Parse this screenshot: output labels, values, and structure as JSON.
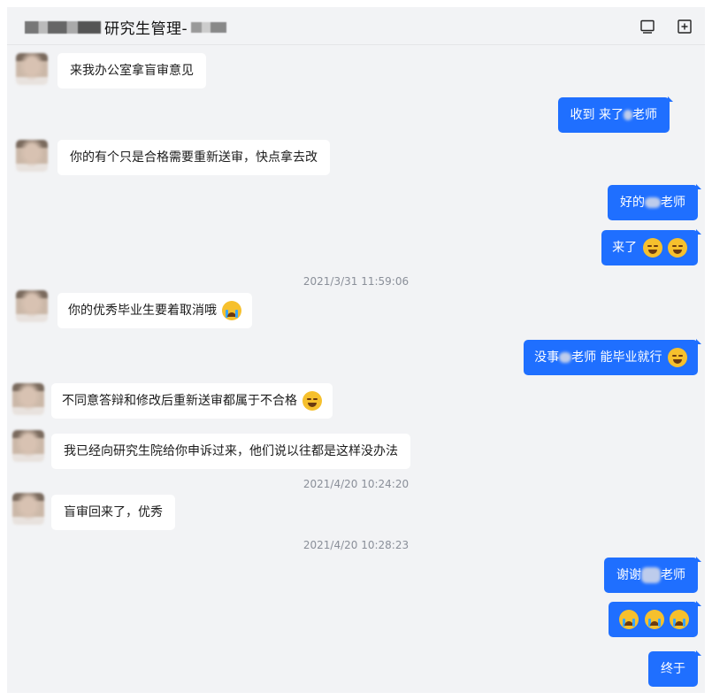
{
  "header": {
    "title": "研究生管理-",
    "icons": [
      "screen-icon",
      "add-box-icon"
    ]
  },
  "messages": [
    {
      "side": "left",
      "text": "来我办公室拿盲审意见"
    },
    {
      "side": "right",
      "pre": "收到 来了",
      "post": "老师"
    },
    {
      "side": "left",
      "text": "你的有个只是合格需要重新送审，快点拿去改"
    },
    {
      "side": "right",
      "pre": "好的",
      "post": "老师"
    },
    {
      "side": "right",
      "pre": "来了",
      "emoji": [
        "laugh-cry-emoji",
        "laugh-cry-emoji"
      ]
    },
    {
      "timestamp": "2021/3/31 11:59:06"
    },
    {
      "side": "left",
      "text": "你的优秀毕业生要着取消哦",
      "emoji": [
        "crying-emoji"
      ]
    },
    {
      "side": "right",
      "pre": "没事",
      "post": "老师 能毕业就行",
      "emoji": [
        "laugh-cry-emoji"
      ]
    },
    {
      "side": "left",
      "text": "不同意答辩和修改后重新送审都属于不合格",
      "emoji": [
        "sad-emoji"
      ]
    },
    {
      "side": "left",
      "text": "我已经向研究生院给你申诉过来，他们说以往都是这样没办法"
    },
    {
      "timestamp": "2021/4/20 10:24:20"
    },
    {
      "side": "left",
      "text": "盲审回来了，优秀"
    },
    {
      "timestamp": "2021/4/20 10:28:23"
    },
    {
      "side": "right",
      "pre": "谢谢",
      "post": "老师"
    },
    {
      "side": "right",
      "emoji": [
        "crying-emoji",
        "crying-emoji",
        "crying-emoji"
      ]
    },
    {
      "side": "right",
      "pre": "终于"
    }
  ]
}
